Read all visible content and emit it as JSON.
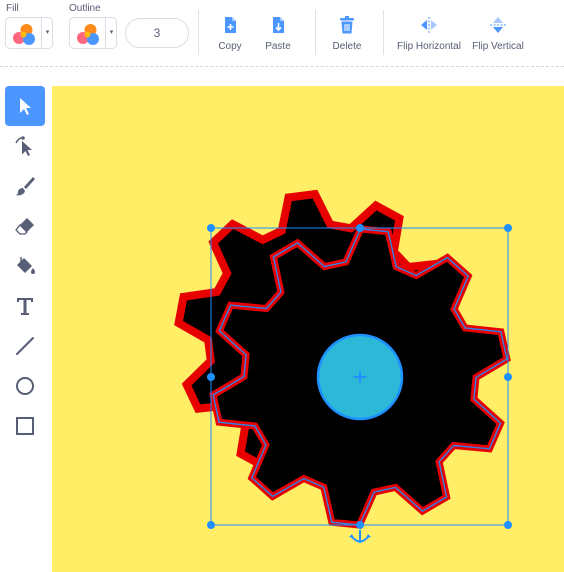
{
  "toolbar": {
    "fill": {
      "label": "Fill",
      "icon": "color-swatch-icon",
      "caret": "▾"
    },
    "outline": {
      "label": "Outline",
      "icon": "color-swatch-icon",
      "caret": "▾"
    },
    "outline_width": "3",
    "actions": {
      "copy": {
        "label": "Copy",
        "icon": "copy-icon"
      },
      "paste": {
        "label": "Paste",
        "icon": "paste-icon"
      },
      "delete": {
        "label": "Delete",
        "icon": "trash-icon"
      },
      "flip_horizontal": {
        "label": "Flip Horizontal",
        "icon": "flip-horizontal-icon"
      },
      "flip_vertical": {
        "label": "Flip Vertical",
        "icon": "flip-vertical-icon"
      }
    }
  },
  "tools": [
    {
      "id": "select",
      "icon": "select-arrow-icon",
      "active": true
    },
    {
      "id": "reshape",
      "icon": "reshape-icon",
      "active": false
    },
    {
      "id": "brush",
      "icon": "brush-icon",
      "active": false
    },
    {
      "id": "eraser",
      "icon": "eraser-icon",
      "active": false
    },
    {
      "id": "fill",
      "icon": "paint-bucket-icon",
      "active": false
    },
    {
      "id": "text",
      "icon": "text-icon",
      "active": false
    },
    {
      "id": "line",
      "icon": "line-icon",
      "active": false
    },
    {
      "id": "circle",
      "icon": "circle-icon",
      "active": false
    },
    {
      "id": "rectangle",
      "icon": "rectangle-icon",
      "active": false
    }
  ],
  "colors": {
    "canvas_background": "#ffee66",
    "shape_fill": "#000000",
    "shape_outline": "#e60000",
    "selection": "#1e90ff",
    "hub": "#2eb8d8",
    "tool_active": "#4c97ff",
    "tool_icon": "#575e75"
  }
}
